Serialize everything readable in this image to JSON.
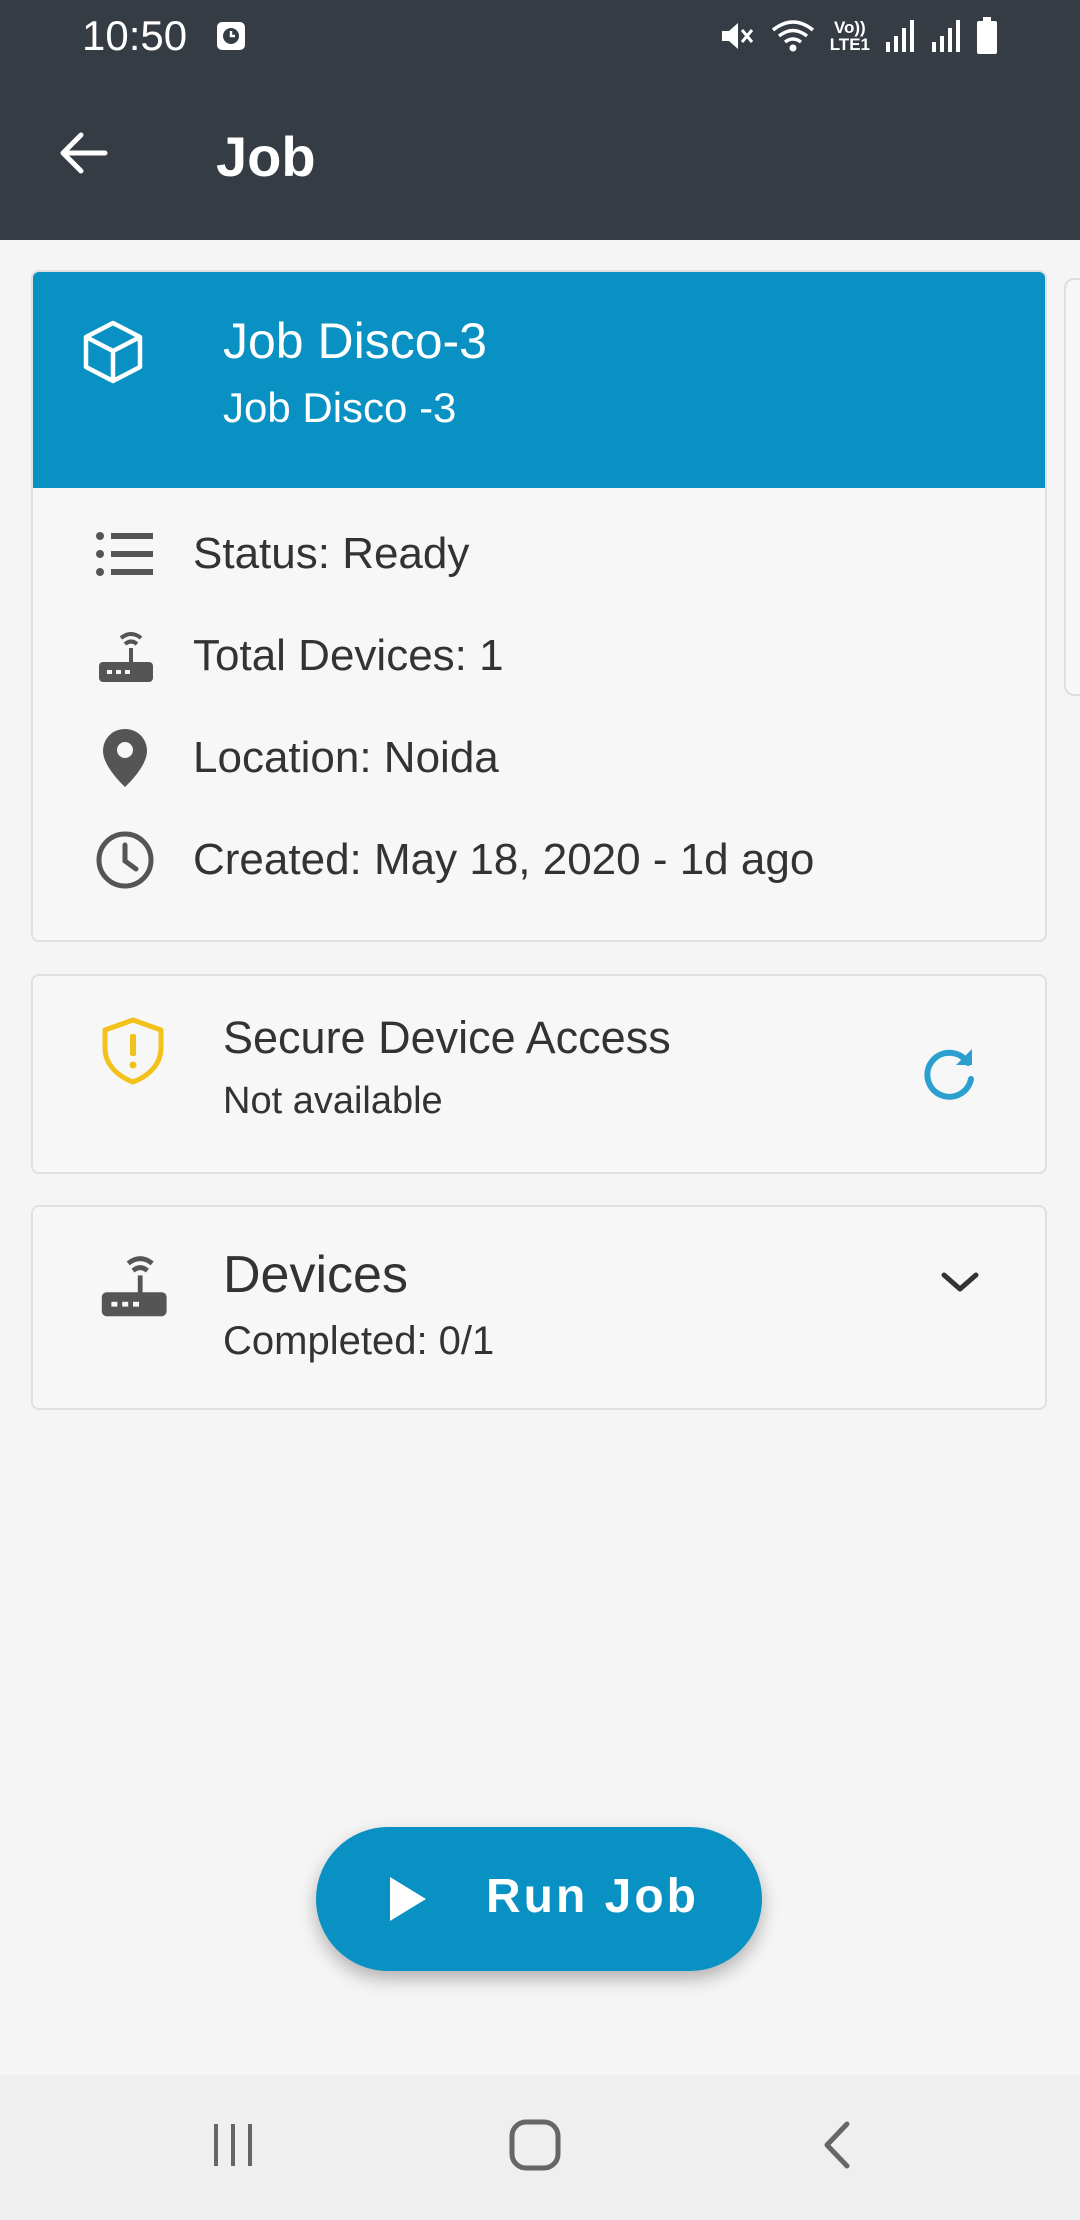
{
  "status_bar": {
    "time": "10:50",
    "volte_label_top": "Vo))",
    "volte_label_bottom": "LTE1",
    "icons": [
      "clock-icon",
      "mute-icon",
      "wifi-icon",
      "volte-icon",
      "signal-icon",
      "signal-icon",
      "battery-icon"
    ]
  },
  "app_bar": {
    "title": "Job",
    "back_icon": "arrow-left-icon"
  },
  "job_card": {
    "title": "Job Disco-3",
    "subtitle": "Job Disco -3",
    "header_color": "#0891c2",
    "icon": "cube-icon",
    "details": [
      {
        "icon": "list-icon",
        "text": "Status: Ready"
      },
      {
        "icon": "router-icon",
        "text": "Total Devices: 1"
      },
      {
        "icon": "location-pin-icon",
        "text": "Location: Noida"
      },
      {
        "icon": "clock-icon",
        "text": "Created: May 18, 2020 - 1d ago"
      }
    ]
  },
  "secure_access": {
    "title": "Secure Device Access",
    "status": "Not available",
    "icon": "shield-warning-icon",
    "icon_color": "#f2c21b",
    "action_icon": "refresh-icon"
  },
  "devices": {
    "title": "Devices",
    "status": "Completed: 0/1",
    "icon": "router-icon",
    "action_icon": "chevron-down-icon"
  },
  "run_button": {
    "label": "Run Job",
    "icon": "play-icon",
    "color": "#0891c2"
  },
  "nav_bar": {
    "buttons": [
      "recents-icon",
      "home-icon",
      "back-icon"
    ]
  }
}
